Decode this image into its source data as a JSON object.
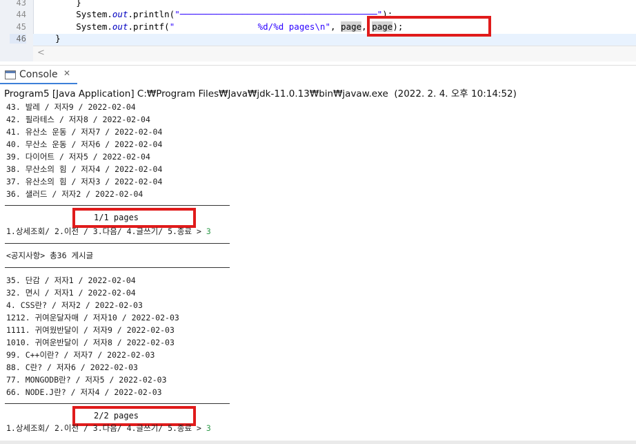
{
  "editor": {
    "lines": [
      {
        "number": "43",
        "code": "        }"
      },
      {
        "number": "44",
        "code_before": "        System.",
        "field": "out",
        "code_middle": ".println(",
        "string": "\"──────────────────────────────────────\"",
        "code_after": ");"
      },
      {
        "number": "45",
        "code_before": "        System.",
        "field": "out",
        "code_middle": ".printf(",
        "string": "\"                %d/%d pages\\n\"",
        "code_after_1": ", ",
        "arg1": "page",
        "code_after_2": ", ",
        "arg2": "page",
        "code_after_3": ");"
      },
      {
        "number": "46",
        "code": "    }"
      }
    ],
    "scroll_left_glyph": "<"
  },
  "console": {
    "tab_label": "Console",
    "close_glyph": "✕",
    "launch_info": "Program5 [Java Application] C:₩Program Files₩Java₩jdk-11.0.13₩bin₩javaw.exe  (2022. 2. 4. 오후 10:14:52)",
    "page1_rows": [
      "43. 발레 / 저자9 / 2022-02-04",
      "42. 필라테스 / 저자8 / 2022-02-04",
      "41. 유산소 운동 / 저자7 / 2022-02-04",
      "40. 무산소 운동 / 저자6 / 2022-02-04",
      "39. 다이어트 / 저자5 / 2022-02-04",
      "38. 무산소의 힘 / 저자4 / 2022-02-04",
      "37. 유산소의 힘 / 저자3 / 2022-02-04",
      "36. 샐러드 / 저자2 / 2022-02-04"
    ],
    "page1_indicator": "1/1 pages",
    "menu_prompt": "1.상세조회/ 2.이전 / 3.다음/ 4.글쓰기/ 5.종료 > ",
    "menu_input_1": "3",
    "notice_header": "<공지사항> 총36 게시글",
    "page2_rows": [
      "35. 단감 / 저자1 / 2022-02-04",
      "32. 면시 / 저자1 / 2022-02-04",
      "4. CSS란? / 저자2 / 2022-02-03",
      "1212. 귀여운달자매 / 저자10 / 2022-02-03",
      "1111. 귀여웠반달이 / 저자9 / 2022-02-03",
      "1010. 귀여운반달이 / 저자8 / 2022-02-03",
      "99. C++이란? / 저자7 / 2022-02-03",
      "88. C란? / 저자6 / 2022-02-03",
      "77. MONGODB란? / 저자5 / 2022-02-03",
      "66. NODE.J란? / 저자4 / 2022-02-03"
    ],
    "page2_indicator": "2/2 pages",
    "menu_input_2": "3"
  },
  "colors": {
    "highlight_box": "#e01b1b",
    "input_text": "#2e9a4a",
    "keyword_field": "#0000c0",
    "string_literal": "#2a00ff"
  }
}
